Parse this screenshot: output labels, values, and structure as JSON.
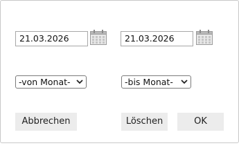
{
  "from_date": {
    "value": "21.03.2026"
  },
  "to_date": {
    "value": "21.03.2026"
  },
  "from_month": {
    "selected": "-von Monat-"
  },
  "to_month": {
    "selected": "-bis Monat-"
  },
  "buttons": {
    "cancel": "Abbrechen",
    "clear": "Löschen",
    "ok": "OK"
  },
  "icons": {
    "calendar": "calendar-icon",
    "dropdown": "chevron-down-icon"
  }
}
